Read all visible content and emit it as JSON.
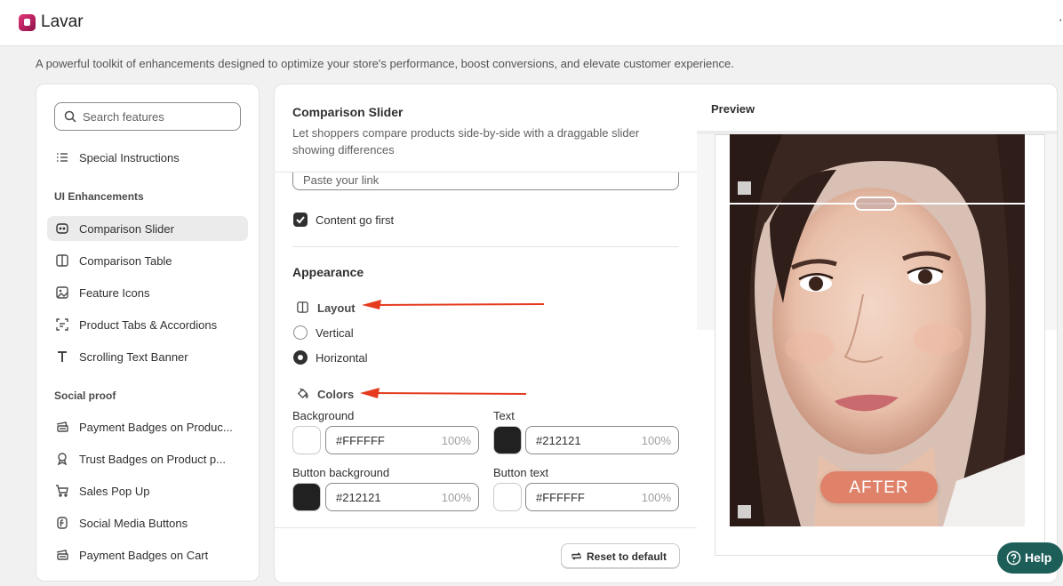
{
  "app": {
    "name": "Lavar",
    "menu_glyph": "·"
  },
  "page": {
    "subtitle": "A powerful toolkit of enhancements designed to optimize your store's performance, boost conversions, and elevate customer experience."
  },
  "sidebar": {
    "search_placeholder": "Search features",
    "top_items": [
      {
        "label": "Special Instructions",
        "icon": "list-icon"
      }
    ],
    "sections": [
      {
        "title": "UI Enhancements",
        "items": [
          {
            "label": "Comparison Slider",
            "icon": "compare-icon",
            "active": true
          },
          {
            "label": "Comparison Table",
            "icon": "columns-icon"
          },
          {
            "label": "Feature Icons",
            "icon": "image-icon"
          },
          {
            "label": "Product Tabs & Accordions",
            "icon": "tabs-icon"
          },
          {
            "label": "Scrolling Text Banner",
            "icon": "text-icon"
          }
        ]
      },
      {
        "title": "Social proof",
        "items": [
          {
            "label": "Payment Badges on Produc...",
            "icon": "cash-icon"
          },
          {
            "label": "Trust Badges on Product p...",
            "icon": "award-icon"
          },
          {
            "label": "Sales Pop Up",
            "icon": "cart-icon"
          },
          {
            "label": "Social Media Buttons",
            "icon": "social-icon"
          },
          {
            "label": "Payment Badges on Cart",
            "icon": "cash-icon"
          }
        ]
      }
    ]
  },
  "feature": {
    "title": "Comparison Slider",
    "description": "Let shoppers compare products side-by-side with a draggable slider showing differences",
    "link_placeholder": "Paste your link",
    "content_first": {
      "label": "Content go first",
      "checked": true
    },
    "appearance_title": "Appearance",
    "layout": {
      "title": "Layout",
      "options": [
        {
          "label": "Vertical",
          "selected": false
        },
        {
          "label": "Horizontal",
          "selected": true
        }
      ]
    },
    "colors": {
      "title": "Colors",
      "fields": [
        {
          "label": "Background",
          "hex": "#FFFFFF",
          "opacity": "100%",
          "swatch": "#ffffff"
        },
        {
          "label": "Text",
          "hex": "#212121",
          "opacity": "100%",
          "swatch": "#212121"
        },
        {
          "label": "Button background",
          "hex": "#212121",
          "opacity": "100%",
          "swatch": "#212121"
        },
        {
          "label": "Button text",
          "hex": "#FFFFFF",
          "opacity": "100%",
          "swatch": "#ffffff"
        }
      ]
    },
    "reset_label": "Reset to default"
  },
  "preview": {
    "title": "Preview",
    "badge": "AFTER"
  },
  "help": {
    "label": "Help"
  },
  "colors": {
    "annotation_arrow": "#e53b1f",
    "help_bg": "#1d5e58"
  }
}
